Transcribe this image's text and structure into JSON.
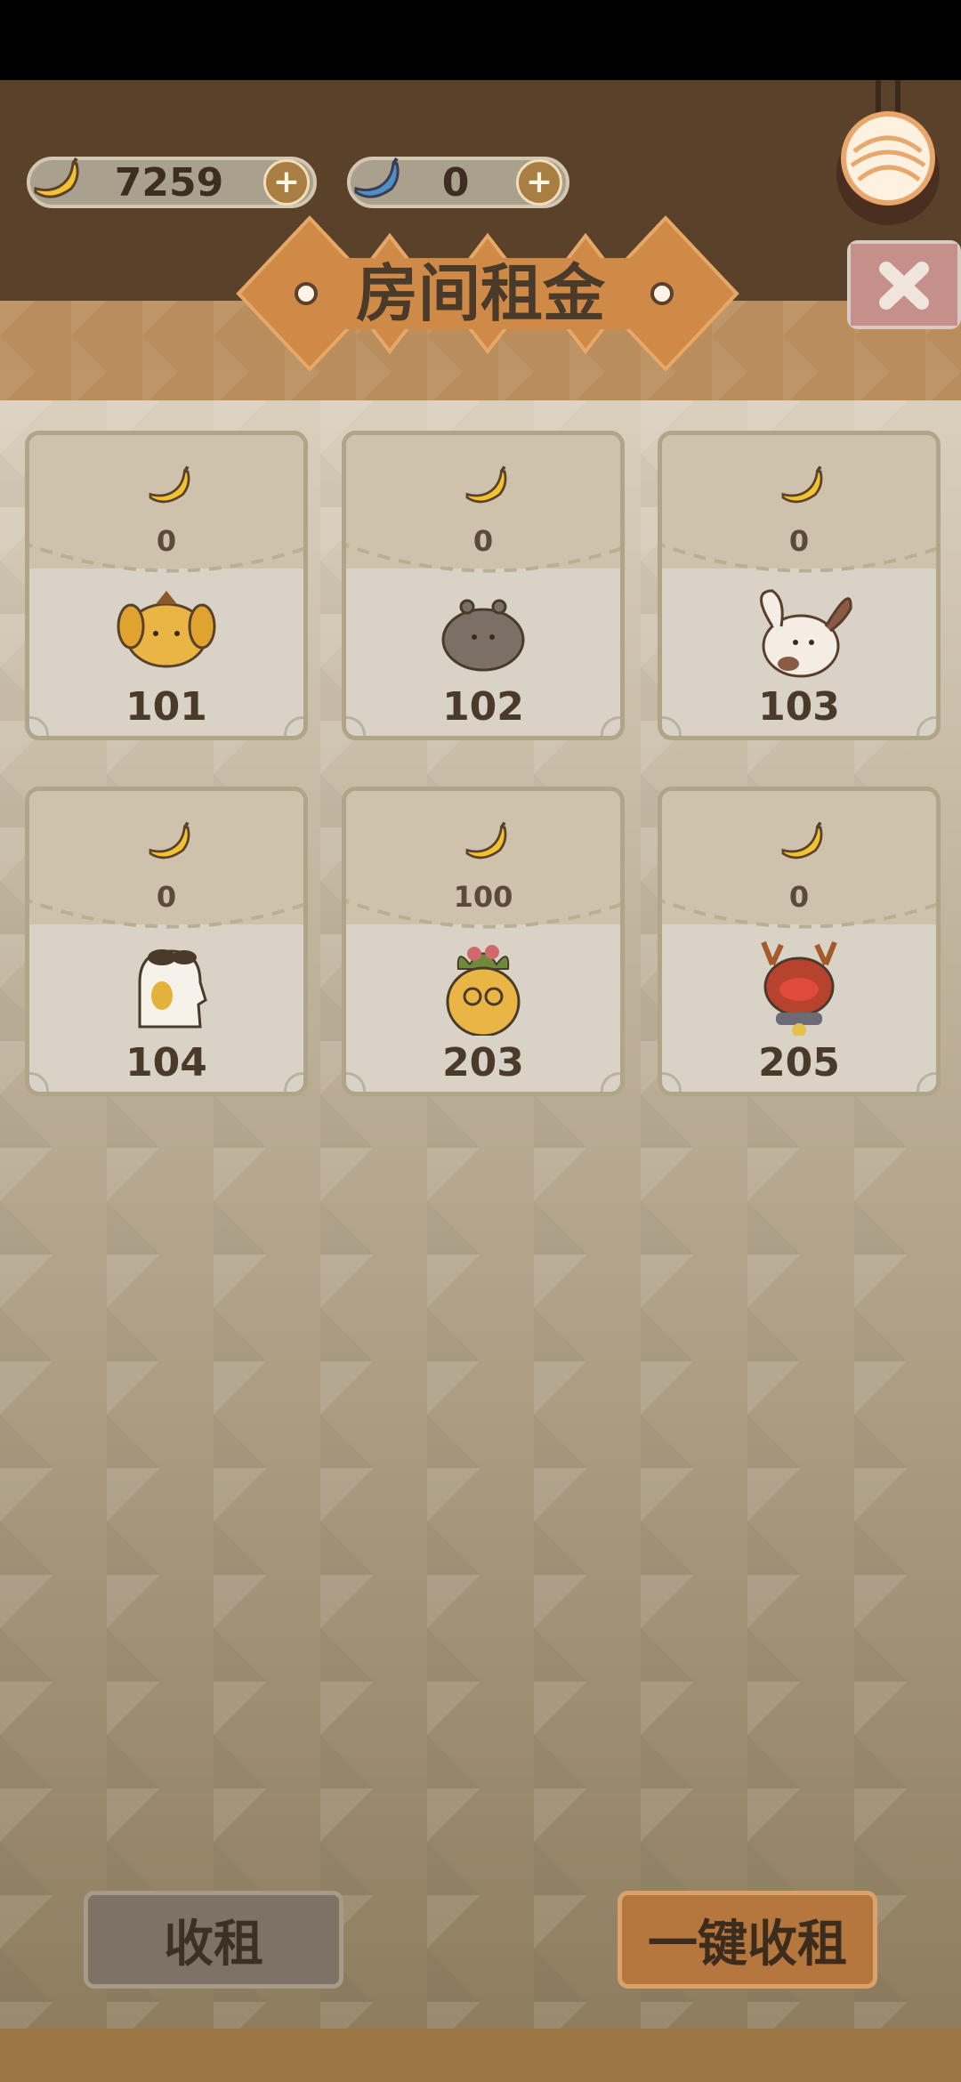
{
  "currencies": [
    {
      "icon": "banana-icon",
      "value": "7259"
    },
    {
      "icon": "blue-banana-icon",
      "value": "0"
    }
  ],
  "title": "房间租金",
  "rooms": [
    {
      "room": "101",
      "rent": "0",
      "pet": "yellow-dog-pet"
    },
    {
      "room": "102",
      "rent": "0",
      "pet": "gray-blob-pet"
    },
    {
      "room": "103",
      "rent": "0",
      "pet": "spotted-bunny-pet"
    },
    {
      "room": "104",
      "rent": "0",
      "pet": "ghost-bird-pet"
    },
    {
      "room": "203",
      "rent": "100",
      "pet": "pineapple-pet"
    },
    {
      "room": "205",
      "rent": "0",
      "pet": "red-reindeer-pet"
    }
  ],
  "buttons": {
    "collect": "收租",
    "collect_all": "一键收租"
  },
  "colors": {
    "accent_orange": "#b5773e",
    "banana_yellow": "#f2c230",
    "text_dark": "#4a3a2a"
  }
}
